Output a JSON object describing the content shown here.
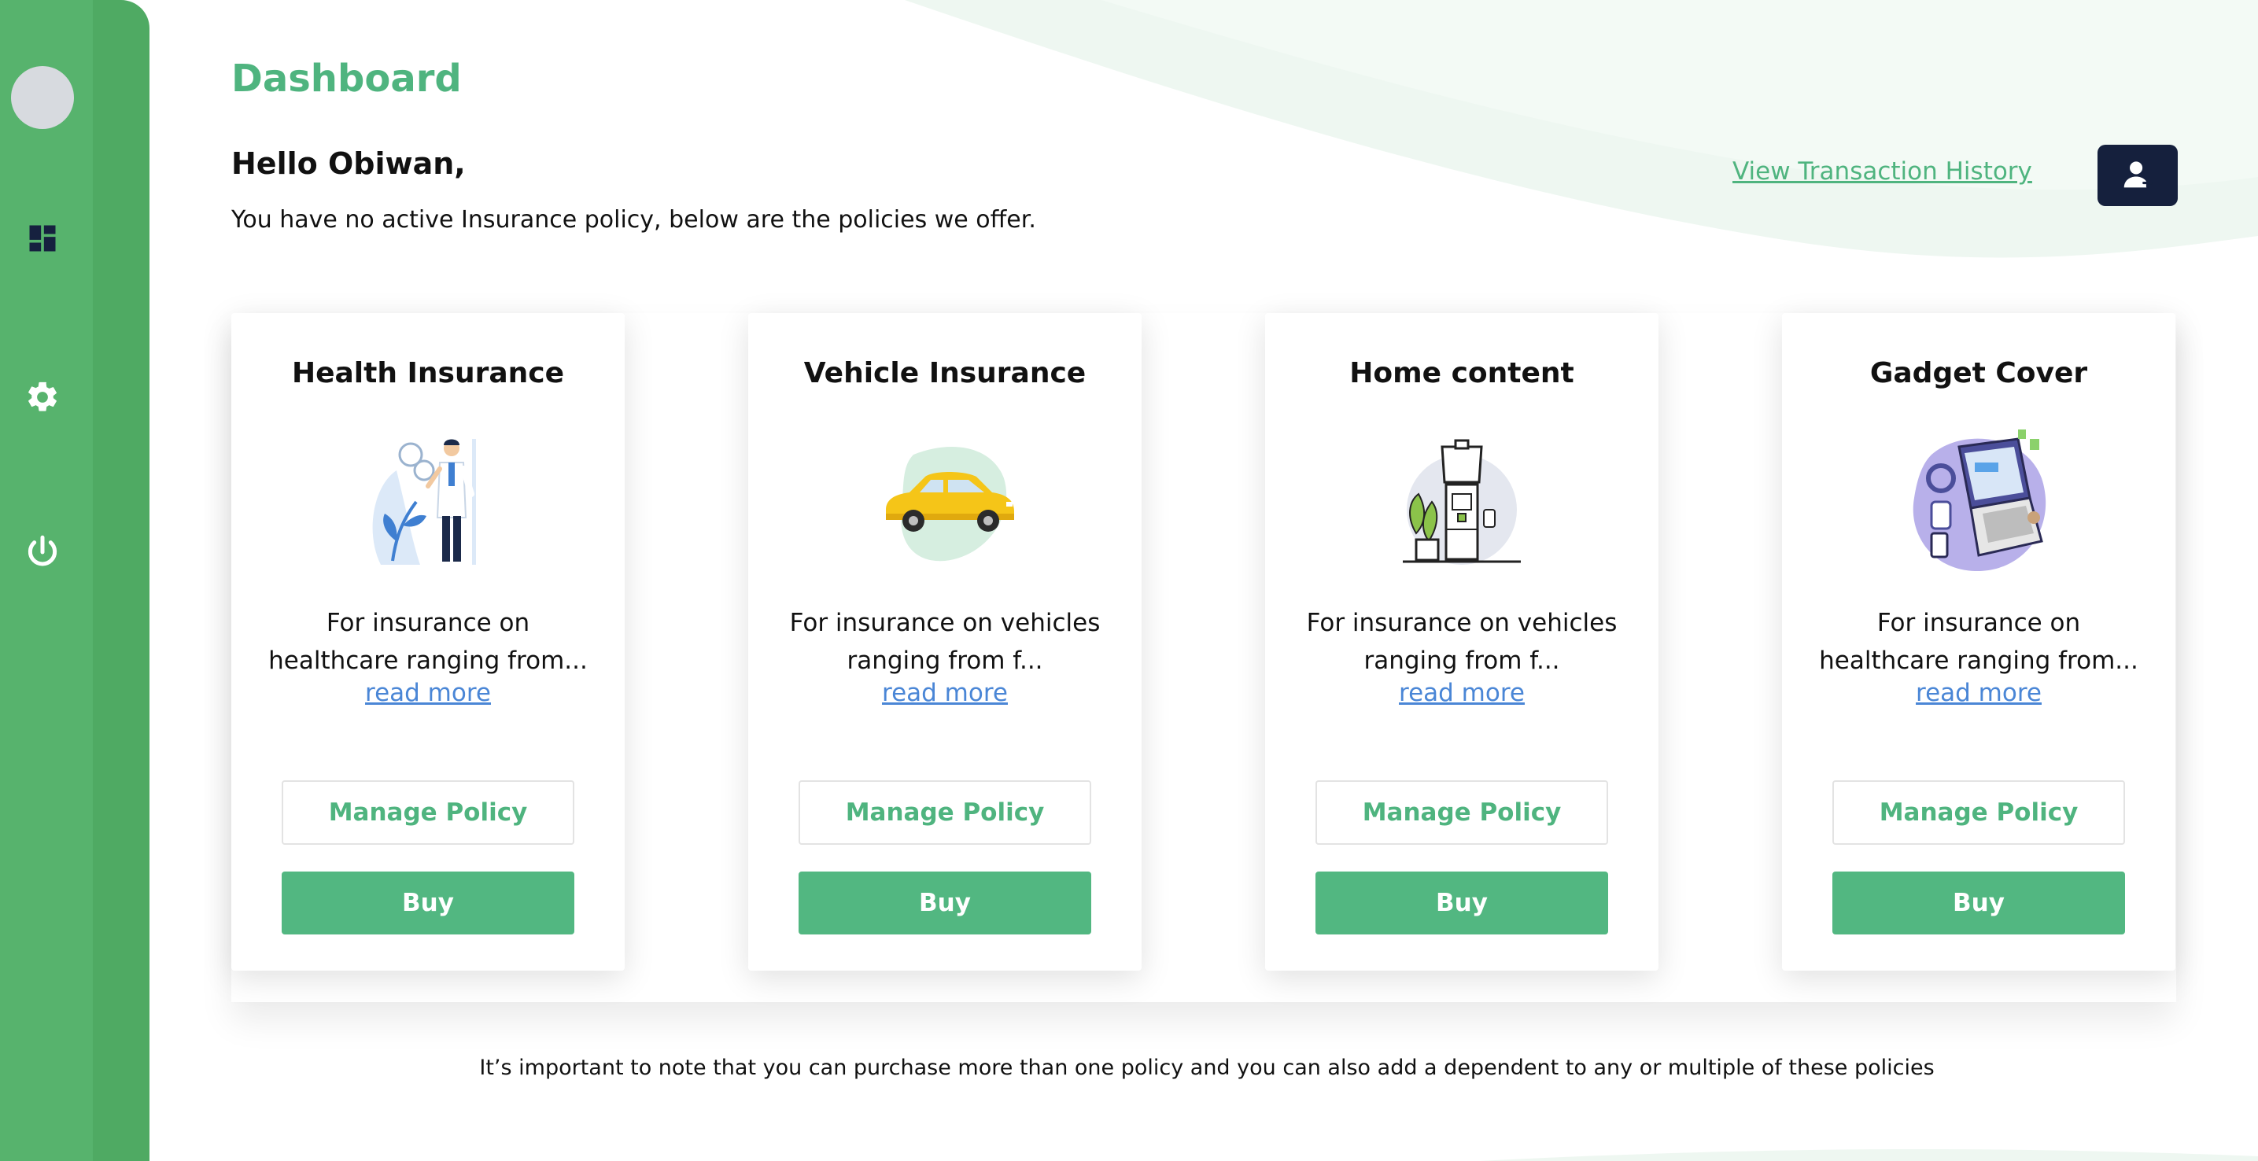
{
  "colors": {
    "sidebar": "#4faa63",
    "accent": "#4fb47f",
    "buy_button": "#52b781",
    "dark_button": "#15203d",
    "link_blue": "#4a86d6"
  },
  "sidebar": {
    "items": [
      {
        "icon": "dashboard-icon"
      },
      {
        "icon": "gear-icon"
      },
      {
        "icon": "power-icon"
      }
    ]
  },
  "header": {
    "title": "Dashboard",
    "greeting": "Hello Obiwan,",
    "subtext": "You have no active Insurance policy, below are the policies we offer.",
    "history_link": "View Transaction History",
    "add_user_icon": "add-user-icon"
  },
  "cards": [
    {
      "title": "Health Insurance",
      "description": "For insurance on healthcare ranging from...",
      "read_more": "read more",
      "manage_label": "Manage Policy",
      "buy_label": "Buy"
    },
    {
      "title": "Vehicle Insurance",
      "description": "For insurance on vehicles ranging from f...",
      "read_more": "read more",
      "manage_label": "Manage Policy",
      "buy_label": "Buy"
    },
    {
      "title": "Home content",
      "description": "For insurance on vehicles ranging from f...",
      "read_more": "read more",
      "manage_label": "Manage Policy",
      "buy_label": "Buy"
    },
    {
      "title": "Gadget Cover",
      "description": "For insurance on healthcare ranging from...",
      "read_more": "read more",
      "manage_label": "Manage Policy",
      "buy_label": "Buy"
    }
  ],
  "footnote": "It’s important to note that you can purchase more than one policy and you can also add a dependent to any or multiple of these policies"
}
